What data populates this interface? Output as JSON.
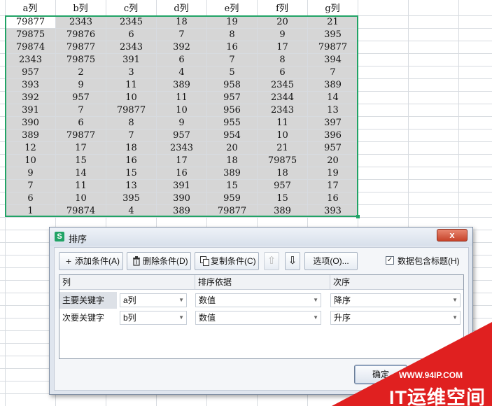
{
  "sheet": {
    "headers": [
      "a列",
      "b列",
      "c列",
      "d列",
      "e列",
      "f列",
      "g列"
    ],
    "rows": [
      [
        "79877",
        "2343",
        "2345",
        "18",
        "19",
        "20",
        "21"
      ],
      [
        "79875",
        "79876",
        "6",
        "7",
        "8",
        "9",
        "395"
      ],
      [
        "79874",
        "79877",
        "2343",
        "392",
        "16",
        "17",
        "79877"
      ],
      [
        "2343",
        "79875",
        "391",
        "6",
        "7",
        "8",
        "394"
      ],
      [
        "957",
        "2",
        "3",
        "4",
        "5",
        "6",
        "7"
      ],
      [
        "393",
        "9",
        "11",
        "389",
        "958",
        "2345",
        "389"
      ],
      [
        "392",
        "957",
        "10",
        "11",
        "957",
        "2344",
        "14"
      ],
      [
        "391",
        "7",
        "79877",
        "10",
        "956",
        "2343",
        "13"
      ],
      [
        "390",
        "6",
        "8",
        "9",
        "955",
        "11",
        "397"
      ],
      [
        "389",
        "79877",
        "7",
        "957",
        "954",
        "10",
        "396"
      ],
      [
        "12",
        "17",
        "18",
        "2343",
        "20",
        "21",
        "957"
      ],
      [
        "10",
        "15",
        "16",
        "17",
        "18",
        "79875",
        "20"
      ],
      [
        "9",
        "14",
        "15",
        "16",
        "389",
        "18",
        "19"
      ],
      [
        "7",
        "11",
        "13",
        "391",
        "15",
        "957",
        "17"
      ],
      [
        "6",
        "10",
        "395",
        "390",
        "959",
        "15",
        "16"
      ],
      [
        "1",
        "79874",
        "4",
        "389",
        "79877",
        "389",
        "393"
      ]
    ]
  },
  "dialog": {
    "app_icon": "S",
    "title": "排序",
    "close_glyph": "x",
    "toolbar": {
      "add": "添加条件(A)",
      "delete": "删除条件(D)",
      "copy": "复制条件(C)",
      "options": "选项(O)...",
      "header_checkbox": "数据包含标题(H)",
      "header_checkbox_checked": "✓"
    },
    "columns": {
      "col": "列",
      "sort_on": "排序依据",
      "order": "次序"
    },
    "conditions": [
      {
        "label": "主要关键字",
        "column": "a列",
        "sort_on": "数值",
        "order": "降序"
      },
      {
        "label": "次要关键字",
        "column": "b列",
        "sort_on": "数值",
        "order": "升序"
      }
    ],
    "ok": "确定",
    "cancel": ""
  },
  "watermark": {
    "url": "WWW.94IP.COM",
    "brand": "IT运维空间",
    "color": "#e02020"
  }
}
